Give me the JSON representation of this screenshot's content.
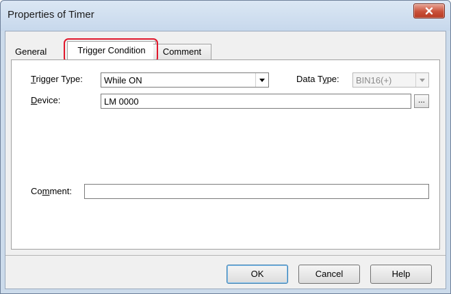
{
  "window": {
    "title": "Properties of Timer"
  },
  "tabs": [
    {
      "label": "General"
    },
    {
      "label": "Trigger Condition"
    },
    {
      "label": "Comment"
    }
  ],
  "trigger": {
    "trigger_type_label_pre": "T",
    "trigger_type_label_rest": "rigger Type:",
    "trigger_type_value": "While ON",
    "data_type_label_pre": "Data T",
    "data_type_label_u": "y",
    "data_type_label_rest": "pe:",
    "data_type_value": "BIN16(+)",
    "device_label_pre": "D",
    "device_label_rest": "evice:",
    "device_value": "LM 0000",
    "browse_label": "...",
    "comment_label_pre": "Co",
    "comment_label_u": "m",
    "comment_label_rest": "ment:",
    "comment_value": ""
  },
  "buttons": {
    "ok": "OK",
    "cancel": "Cancel",
    "help": "Help"
  },
  "colors": {
    "highlight": "#e0162b",
    "close": "#c9513a"
  }
}
